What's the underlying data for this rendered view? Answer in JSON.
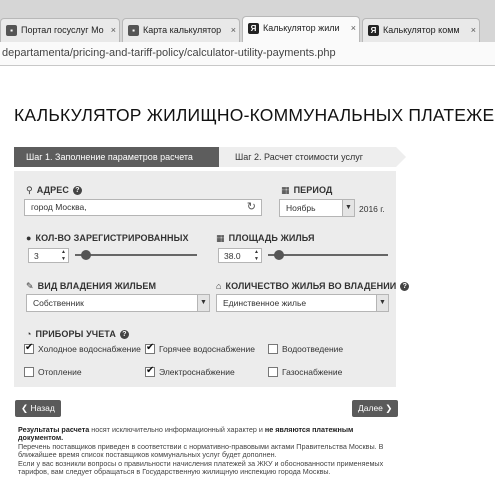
{
  "browser": {
    "tabs": [
      {
        "label": "Портал госуслуг Мо",
        "favicon": "gov-favicon"
      },
      {
        "label": "Карта калькулятор",
        "favicon": "gov-favicon"
      },
      {
        "label": "Калькулятор жили",
        "favicon": "yandex-favicon",
        "active": true
      },
      {
        "label": "Калькулятор комм",
        "favicon": "yandex-favicon"
      }
    ],
    "url": "departamenta/pricing-and-tariff-policy/calculator-utility-payments.php"
  },
  "page": {
    "title": "КАЛЬКУЛЯТОР ЖИЛИЩНО-КОММУНАЛЬНЫХ ПЛАТЕЖЕЙ",
    "steps": {
      "step1": "Шаг 1. Заполнение параметров расчета",
      "step2": "Шаг 2. Расчет стоимости услуг"
    }
  },
  "form": {
    "address": {
      "label": "АДРЕС",
      "value": "город Москва,"
    },
    "period": {
      "label": "ПЕРИОД",
      "month": "Ноябрь",
      "year": "2016 г."
    },
    "registered": {
      "label": "КОЛ-ВО ЗАРЕГИСТРИРОВАННЫХ",
      "value": "3",
      "slider_fraction": 0.09
    },
    "area": {
      "label": "ПЛОЩАДЬ ЖИЛЬЯ",
      "value": "38.0",
      "slider_fraction": 0.09
    },
    "ownership": {
      "label": "ВИД ВЛАДЕНИЯ ЖИЛЬЕМ",
      "value": "Собственник"
    },
    "housing_count": {
      "label": "КОЛИЧЕСТВО ЖИЛЬЯ ВО ВЛАДЕНИИ",
      "value": "Единственное жилье"
    },
    "meters": {
      "label": "ПРИБОРЫ УЧЕТА",
      "items": [
        {
          "label": "Холодное водоснабжение",
          "checked": true
        },
        {
          "label": "Горячее водоснабжение",
          "checked": true
        },
        {
          "label": "Водоотведение",
          "checked": false
        },
        {
          "label": "Отопление",
          "checked": false
        },
        {
          "label": "Электроснабжение",
          "checked": true
        },
        {
          "label": "Газоснабжение",
          "checked": false
        }
      ]
    }
  },
  "nav": {
    "back": "Назад",
    "next": "Далее"
  },
  "footnote": {
    "bold1": "Результаты расчета",
    "text1": " носят исключительно информационный характер и ",
    "bold2": "не являются платежным документом.",
    "text2": "Перечень поставщиков приведен в соответствии с нормативно-правовыми актами Правительства Москвы. В ближайшее время список поставщиков коммунальных услуг будет дополнен.",
    "text3": "Если у вас возникли вопросы о правильности начисления платежей за ЖКУ и обоснованности применяемых тарифов, вам следует обращаться в Государственную жилищную инспекцию города Москвы."
  }
}
